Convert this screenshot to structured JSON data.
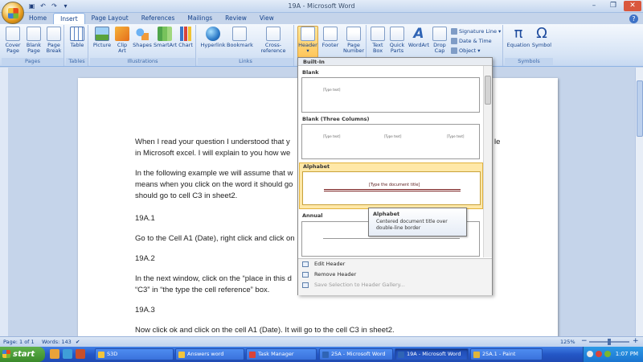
{
  "window": {
    "title": "19A - Microsoft Word"
  },
  "tabs": [
    "Home",
    "Insert",
    "Page Layout",
    "References",
    "Mailings",
    "Review",
    "View"
  ],
  "ribbon": {
    "pages": {
      "label": "Pages",
      "cover": "Cover\nPage",
      "blank": "Blank\nPage",
      "break": "Page\nBreak"
    },
    "tables": {
      "label": "Tables",
      "table": "Table"
    },
    "illustrations": {
      "label": "Illustrations",
      "picture": "Picture",
      "clipart": "Clip\nArt",
      "shapes": "Shapes",
      "smartart": "SmartArt",
      "chart": "Chart"
    },
    "links": {
      "label": "Links",
      "hyperlink": "Hyperlink",
      "bookmark": "Bookmark",
      "xref": "Cross-reference"
    },
    "hf": {
      "header": "Header",
      "footer": "Footer",
      "pagenum": "Page\nNumber"
    },
    "text": {
      "textbox": "Text\nBox",
      "quickparts": "Quick\nParts",
      "wordart": "WordArt",
      "dropcap": "Drop\nCap",
      "sigline": "Signature Line",
      "datetime": "Date & Time",
      "object": "Object"
    },
    "symbols": {
      "label": "Symbols",
      "equation": "Equation",
      "symbol": "Symbol",
      "pi": "π",
      "omega": "Ω"
    }
  },
  "document": {
    "p1": "When I read your question I understood that y",
    "p1b": "le",
    "p2": "in Microsoft excel. I will explain to you how we",
    "p3": "In the following example we will assume that w",
    "p4": "means when you click on the word it should go",
    "p5": "should go to cell C3 in sheet2.",
    "h1": "19A.1",
    "p6": "Go to the Cell A1 (Date), right click and click on",
    "h2": "19A.2",
    "p7": "In the next window, click on the “place in this d",
    "p8": "“C3” in “the type the cell reference” box.",
    "h3": "19A.3",
    "p9": "Now click ok and click on the cell A1 (Date). It will go to the cell C3 in sheet2."
  },
  "gallery": {
    "heading": "Built-In",
    "sections": [
      "Blank",
      "Blank (Three Columns)",
      "Alphabet",
      "Annual"
    ],
    "placeholder": "[Type text]",
    "alphabet_title": "[Type the document title]",
    "menu": [
      "Edit Header",
      "Remove Header",
      "Save Selection to Header Gallery..."
    ]
  },
  "tooltip": {
    "title": "Alphabet",
    "desc": "Centered document title over double-line border"
  },
  "status": {
    "page": "Page: 1 of 1",
    "words": "Words: 143",
    "zoom": "125%"
  },
  "taskbar": {
    "start": "start",
    "tasks": [
      "S3D",
      "Answers word",
      "Task Manager",
      "25A - Microsoft Word",
      "19A - Microsoft Word",
      "25A.1 - Paint"
    ],
    "clock": "1:07 PM"
  }
}
